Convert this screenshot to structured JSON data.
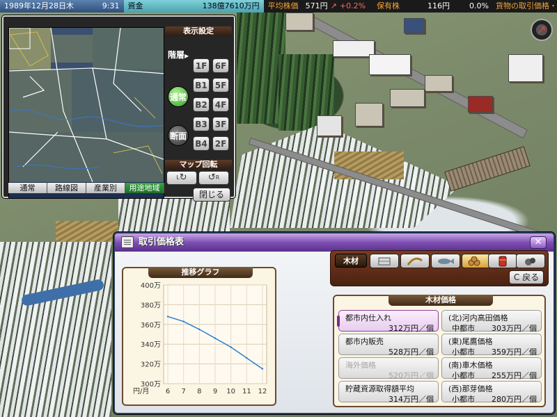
{
  "status_bar": {
    "date": "1989年12月28日木",
    "time": "9:31",
    "funds_label": "資金",
    "funds_value": "138億7610万円",
    "avg_price_label": "平均株価",
    "avg_price_value": "571円",
    "avg_price_change": "+0.2%",
    "holdings_label": "保有株",
    "holdings_value": "116円",
    "holdings_change": "0.0%",
    "ticker": "貨物の取引価格・"
  },
  "minimap": {
    "tabs": [
      "通常",
      "路線図",
      "産業別",
      "用途地域"
    ],
    "active_tab_index": 3,
    "display_settings_label": "表示設定",
    "floor_label": "階層",
    "mode_normal": "通常",
    "mode_section": "断面",
    "floors_left": [
      "1F",
      "B1",
      "B2",
      "B3",
      "B4"
    ],
    "floors_right": [
      "6F",
      "5F",
      "4F",
      "3F",
      "2F"
    ],
    "rotation_label": "マップ回転",
    "rotate_left_label": "L",
    "rotate_right_label": "R",
    "close_label": "閉じる"
  },
  "trade_window": {
    "title": "取引価格表",
    "close_glyph": "✕",
    "selected_category": "木材",
    "category_icons": [
      "stone-icon",
      "wheat-icon",
      "fish-icon",
      "lumber-icon",
      "oil-drum-icon",
      "ore-icon"
    ],
    "active_category_index": 3,
    "back_label": "戻る",
    "graph_title": "推移グラフ",
    "price_title": "木材価格",
    "prices": [
      {
        "name": "都市内仕入れ",
        "region": "",
        "value": "312万円／個",
        "selected": true,
        "disabled": false
      },
      {
        "name": "(北)河内高田価格",
        "region": "中都市",
        "value": "303万円／個",
        "selected": false,
        "disabled": false
      },
      {
        "name": "都市内販売",
        "region": "",
        "value": "528万円／個",
        "selected": false,
        "disabled": false
      },
      {
        "name": "(東)尾鷹価格",
        "region": "小都市",
        "value": "359万円／個",
        "selected": false,
        "disabled": false
      },
      {
        "name": "海外価格",
        "region": "",
        "value": "520万円／個",
        "selected": false,
        "disabled": true
      },
      {
        "name": "(南)車木価格",
        "region": "小都市",
        "value": "255万円／個",
        "selected": false,
        "disabled": false
      },
      {
        "name": "貯蔵資源取得額平均",
        "region": "",
        "value": "314万円／個",
        "selected": false,
        "disabled": false
      },
      {
        "name": "(西)那芽価格",
        "region": "小都市",
        "value": "280万円／個",
        "selected": false,
        "disabled": false
      }
    ]
  },
  "chart_data": {
    "type": "line",
    "title": "推移グラフ",
    "xlabel": "円/月",
    "ylabel": "",
    "x": [
      6,
      7,
      8,
      9,
      10,
      11,
      12
    ],
    "x_ticks": [
      "6",
      "7",
      "8",
      "9",
      "10",
      "11",
      "12"
    ],
    "y_ticks": [
      "300万",
      "320万",
      "340万",
      "360万",
      "380万",
      "400万"
    ],
    "ylim": [
      300,
      400
    ],
    "series": [
      {
        "values": [
          368,
          363,
          355,
          346,
          337,
          326,
          315
        ],
        "color": "#2a7fd0"
      }
    ],
    "grid": true
  }
}
